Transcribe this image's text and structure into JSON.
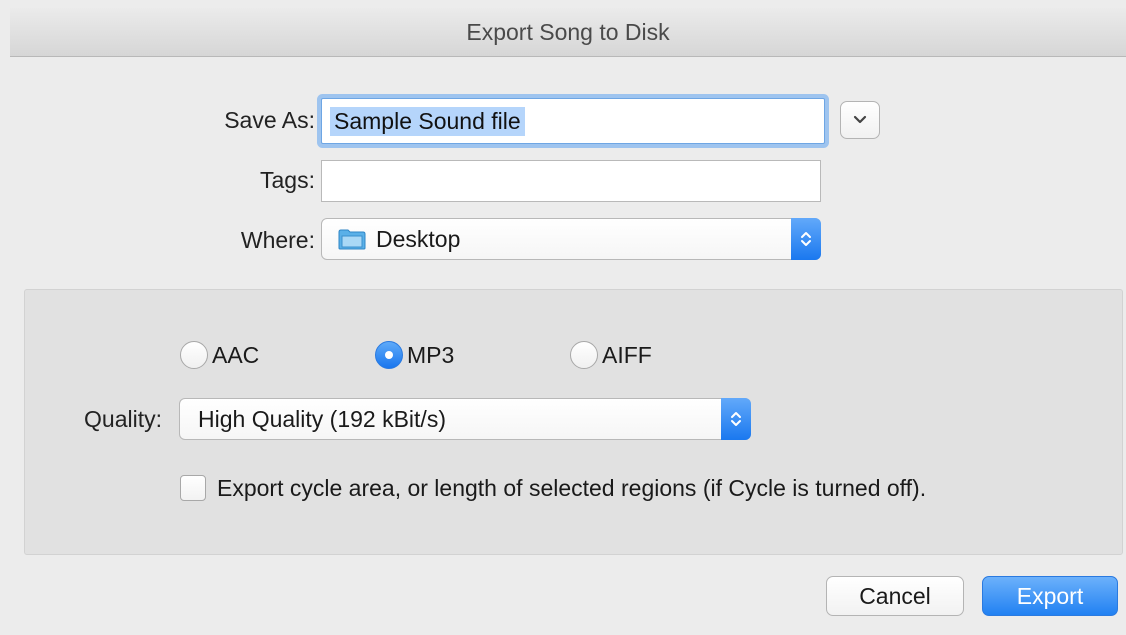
{
  "window": {
    "title": "Export Song to Disk"
  },
  "save_as": {
    "label": "Save As:",
    "value": "Sample Sound file"
  },
  "tags": {
    "label": "Tags:",
    "value": ""
  },
  "where": {
    "label": "Where:",
    "value": "Desktop",
    "icon": "folder-icon"
  },
  "format": {
    "options": [
      {
        "label": "AAC",
        "selected": false
      },
      {
        "label": "MP3",
        "selected": true
      },
      {
        "label": "AIFF",
        "selected": false
      }
    ]
  },
  "quality": {
    "label": "Quality:",
    "value": "High Quality (192 kBit/s)"
  },
  "cycle_option": {
    "label": "Export cycle area, or length of selected regions (if Cycle is turned off).",
    "checked": false
  },
  "buttons": {
    "cancel": "Cancel",
    "export": "Export"
  },
  "colors": {
    "accent": "#2181f2",
    "selection": "#b5d5fb",
    "panel": "#e1e1e1"
  }
}
